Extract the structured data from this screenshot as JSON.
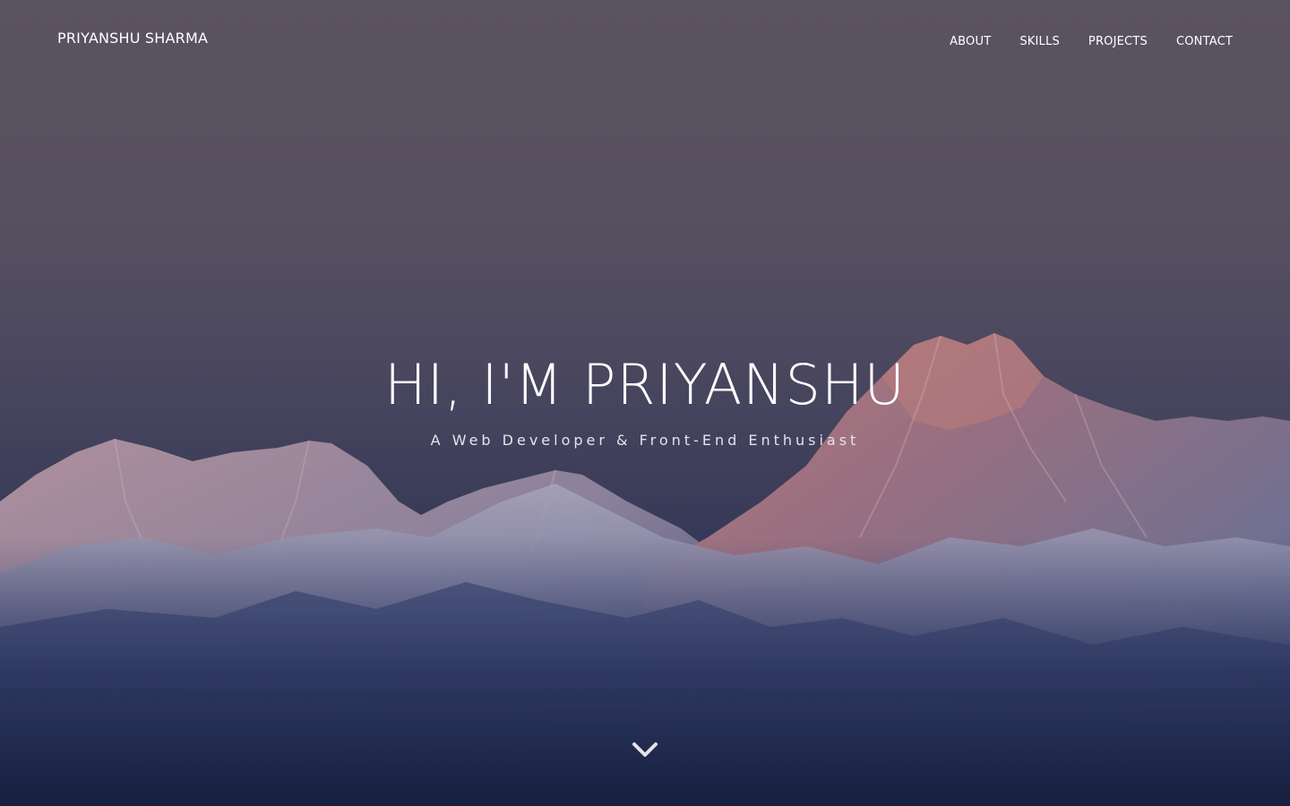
{
  "navbar": {
    "brand": "PRIYANSHU SHARMA",
    "links": [
      {
        "label": "ABOUT"
      },
      {
        "label": "SKILLS"
      },
      {
        "label": "PROJECTS"
      },
      {
        "label": "CONTACT"
      }
    ]
  },
  "hero": {
    "headline": "HI, I'M PRIYANSHU",
    "subheadline": "A Web Developer & Front-End Enthusiast",
    "scroll_icon": "chevron-down-icon"
  },
  "colors": {
    "sky_top": "#615a66",
    "sky_bottom": "#182343",
    "peak_glow": "#c77e7e",
    "text": "#ffffff"
  }
}
